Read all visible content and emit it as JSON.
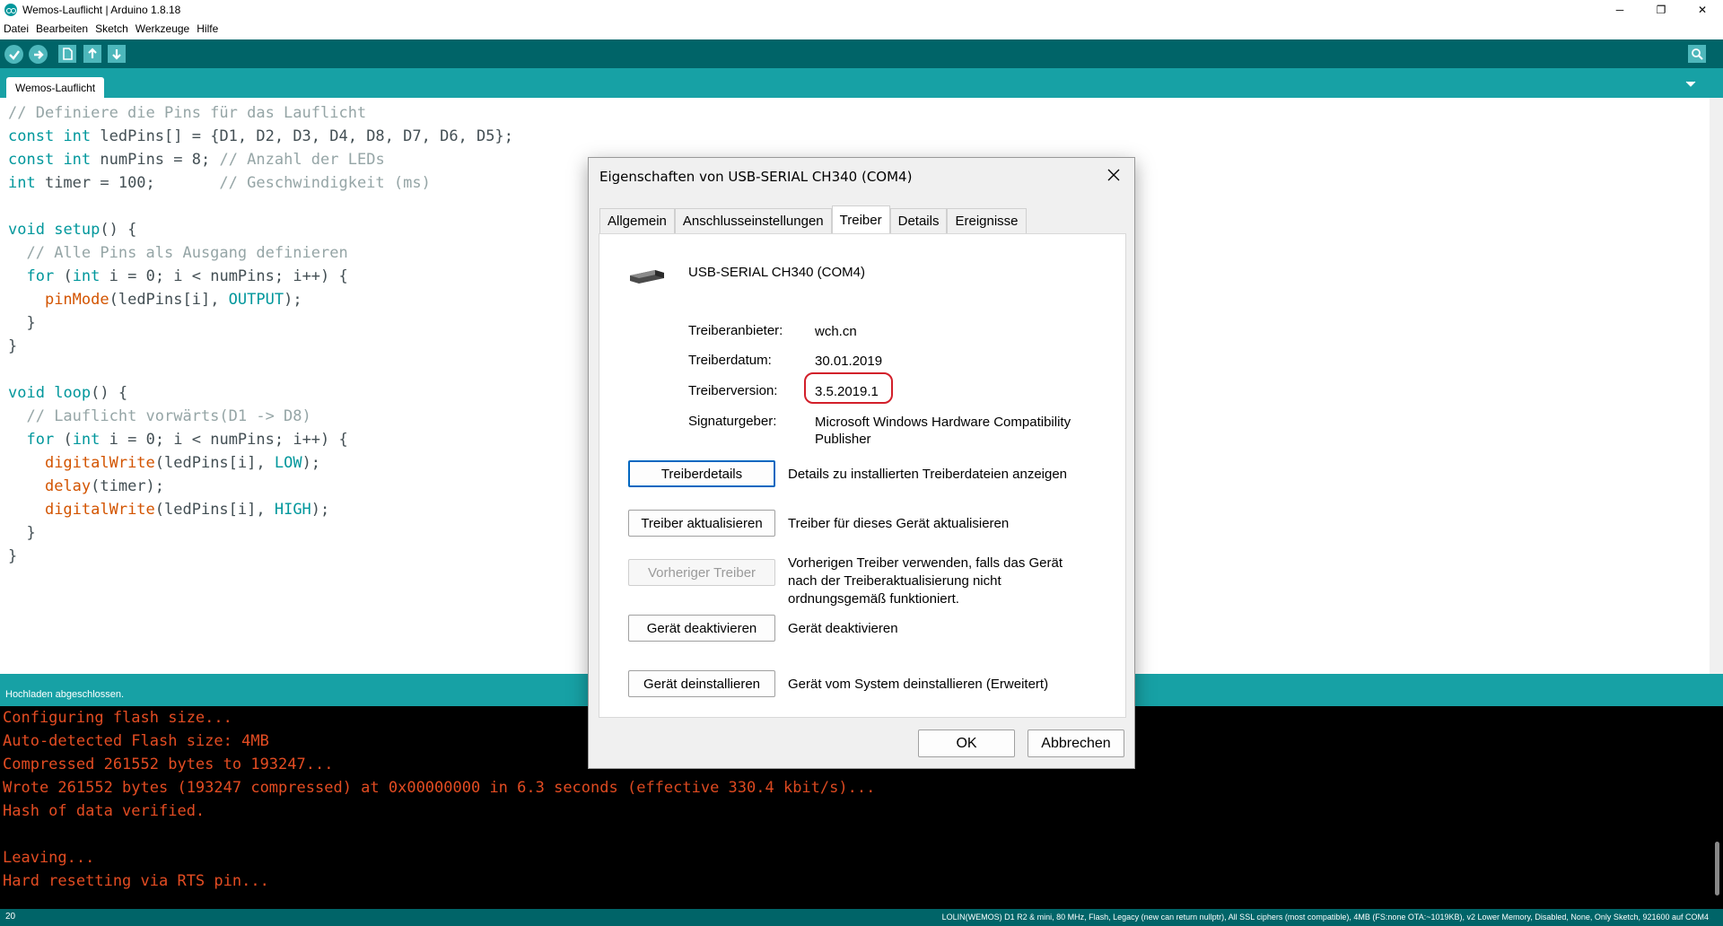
{
  "window": {
    "title": "Wemos-Lauflicht | Arduino 1.8.18",
    "minimize": "─",
    "maximize": "❐",
    "close": "✕"
  },
  "menu": [
    "Datei",
    "Bearbeiten",
    "Sketch",
    "Werkzeuge",
    "Hilfe"
  ],
  "toolbar": {
    "buttons": [
      "verify-icon",
      "upload-icon",
      "new-icon",
      "open-icon",
      "save-icon",
      "serial-monitor-icon"
    ]
  },
  "tab": {
    "name": "Wemos-Lauflicht"
  },
  "code": {
    "lines": [
      "// Definiere die Pins für das Lauflicht",
      "const int ledPins[] = {D1, D2, D3, D4, D8, D7, D6, D5};",
      "const int numPins = 8; // Anzahl der LEDs",
      "int timer = 100;       // Geschwindigkeit (ms)",
      "",
      "void setup() {",
      "  // Alle Pins als Ausgang definieren",
      "  for (int i = 0; i < numPins; i++) {",
      "    pinMode(ledPins[i], OUTPUT);",
      "  }",
      "}",
      "",
      "void loop() {",
      "  // Lauflicht vorwärts(D1 -> D8)",
      "  for (int i = 0; i < numPins; i++) {",
      "    digitalWrite(ledPins[i], LOW);",
      "    delay(timer);",
      "    digitalWrite(ledPins[i], HIGH);",
      "  }",
      "}"
    ]
  },
  "status": {
    "message": "Hochladen abgeschlossen."
  },
  "console": {
    "lines": [
      "Configuring flash size...",
      "Auto-detected Flash size: 4MB",
      "Compressed 261552 bytes to 193247...",
      "Wrote 261552 bytes (193247 compressed) at 0x00000000 in 6.3 seconds (effective 330.4 kbit/s)...",
      "Hash of data verified.",
      "",
      "Leaving...",
      "Hard resetting via RTS pin..."
    ]
  },
  "footer": {
    "line": "20",
    "board": "LOLIN(WEMOS) D1 R2 & mini, 80 MHz, Flash, Legacy (new can return nullptr), All SSL ciphers (most compatible), 4MB (FS:none OTA:~1019KB), v2 Lower Memory, Disabled, None, Only Sketch, 921600 auf COM4"
  },
  "dialog": {
    "title": "Eigenschaften von USB-SERIAL CH340 (COM4)",
    "tabs": [
      "Allgemein",
      "Anschlusseinstellungen",
      "Treiber",
      "Details",
      "Ereignisse"
    ],
    "active_tab": "Treiber",
    "device_name": "USB-SERIAL CH340 (COM4)",
    "props": [
      {
        "label": "Treiberanbieter:",
        "value": "wch.cn"
      },
      {
        "label": "Treiberdatum:",
        "value": "30.01.2019"
      },
      {
        "label": "Treiberversion:",
        "value": "3.5.2019.1"
      },
      {
        "label": "Signaturgeber:",
        "value": "Microsoft Windows Hardware Compatibility Publisher"
      }
    ],
    "actions": [
      {
        "button": "Treiberdetails",
        "desc": "Details zu installierten Treiberdateien anzeigen"
      },
      {
        "button": "Treiber aktualisieren",
        "desc": "Treiber für dieses Gerät aktualisieren"
      },
      {
        "button": "Vorheriger Treiber",
        "desc": "Vorherigen Treiber verwenden, falls das Gerät nach der Treiberaktualisierung nicht ordnungsgemäß funktioniert."
      },
      {
        "button": "Gerät deaktivieren",
        "desc": "Gerät deaktivieren"
      },
      {
        "button": "Gerät deinstallieren",
        "desc": "Gerät vom System deinstallieren (Erweitert)"
      }
    ],
    "ok": "OK",
    "cancel": "Abbrechen",
    "close": "✕"
  },
  "colors": {
    "arduino_dark": "#006468",
    "arduino_teal": "#17a1a5",
    "console_text": "#e34c22",
    "highlight": "#d21f2a"
  }
}
